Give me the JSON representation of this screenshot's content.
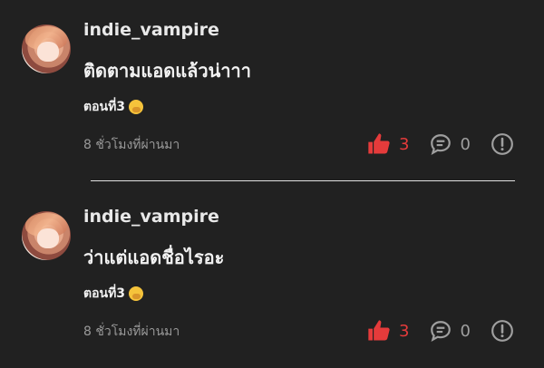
{
  "comments": [
    {
      "username": "indie_vampire",
      "text": "ติดตามแอดแล้วน่าาา",
      "chapter": "ตอนที่3",
      "time": "8 ชั่วโมงที่ผ่านมา",
      "likes": "3",
      "replies": "0"
    },
    {
      "username": "indie_vampire",
      "text": "ว่าแต่แอดชื่อไรอะ",
      "chapter": "ตอนที่3",
      "time": "8 ชั่วโมงที่ผ่านมา",
      "likes": "3",
      "replies": "0"
    }
  ],
  "icons": {
    "like": "thumbs-up-icon",
    "reply": "speech-bubble-icon",
    "report": "exclamation-circle-icon",
    "chapter_emoji": "thinking-face-emoji"
  },
  "colors": {
    "background": "#212121",
    "like": "#e53b3b",
    "muted": "#9a9a9a"
  }
}
